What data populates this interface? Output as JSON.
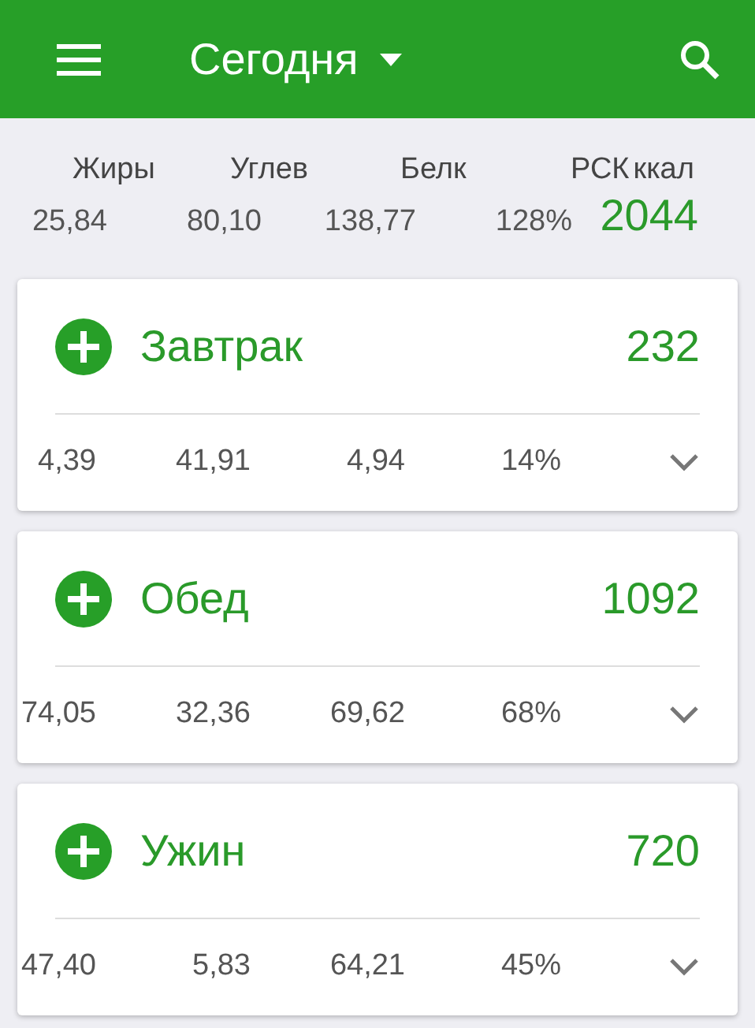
{
  "app_bar": {
    "title": "Сегодня"
  },
  "summary": {
    "labels": [
      "Жиры",
      "Углев",
      "Белк",
      "РСК",
      "ккал"
    ],
    "values": [
      "25,84",
      "80,10",
      "138,77",
      "128%"
    ],
    "kcal": "2044"
  },
  "meals": [
    {
      "name": "Завтрак",
      "kcal": "232",
      "stats": [
        "4,39",
        "41,91",
        "4,94",
        "14%"
      ],
      "expanded": false
    },
    {
      "name": "Обед",
      "kcal": "1092",
      "stats": [
        "74,05",
        "32,36",
        "69,62",
        "68%"
      ],
      "expanded": false
    },
    {
      "name": "Ужин",
      "kcal": "720",
      "stats": [
        "47,40",
        "5,83",
        "64,21",
        "45%"
      ],
      "expanded": false
    }
  ]
}
